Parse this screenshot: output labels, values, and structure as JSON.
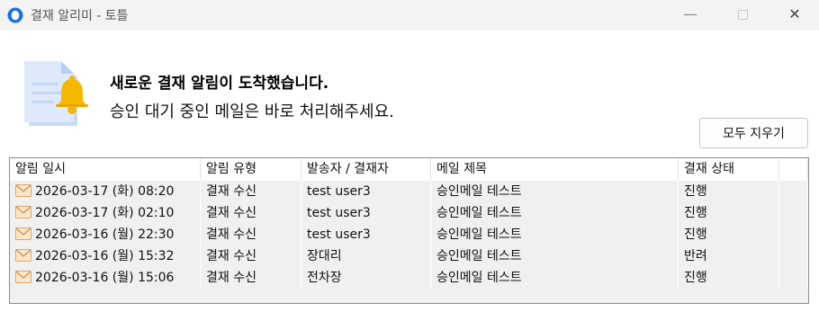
{
  "window": {
    "title": "결재 알리미 - 토틀",
    "min_glyph": "—",
    "close_glyph": "✕"
  },
  "header": {
    "headline": "새로운 결재 알림이 도착했습니다.",
    "subline": "승인 대기 중인 메일은 바로 처리해주세요.",
    "icon": "document-bell-icon"
  },
  "toolbar": {
    "clear_label": "모두 지우기"
  },
  "table": {
    "columns": [
      "알림 일시",
      "알림 유형",
      "발송자 / 결재자",
      "메일 제목",
      "결재 상태",
      ""
    ],
    "rows": [
      {
        "time": "2026-03-17 (화) 08:20",
        "type": "결재 수신",
        "sender": "test user3",
        "subject": "승인메일 테스트",
        "status": "진행"
      },
      {
        "time": "2026-03-17 (화) 02:10",
        "type": "결재 수신",
        "sender": "test user3",
        "subject": "승인메일 테스트",
        "status": "진행"
      },
      {
        "time": "2026-03-16 (월) 22:30",
        "type": "결재 수신",
        "sender": "test user3",
        "subject": "승인메일 테스트",
        "status": "진행"
      },
      {
        "time": "2026-03-16 (월) 15:32",
        "type": "결재 수신",
        "sender": "장대리",
        "subject": "승인메일 테스트",
        "status": "반려"
      },
      {
        "time": "2026-03-16 (월) 15:06",
        "type": "결재 수신",
        "sender": "전차장",
        "subject": "승인메일 테스트",
        "status": "진행"
      }
    ],
    "row_icon": "envelope-icon"
  },
  "colors": {
    "accent": "#1e6fe8",
    "bell": "#f5b800",
    "titlebar": "#f3f3f3",
    "table_bg": "#f0f0f0"
  }
}
